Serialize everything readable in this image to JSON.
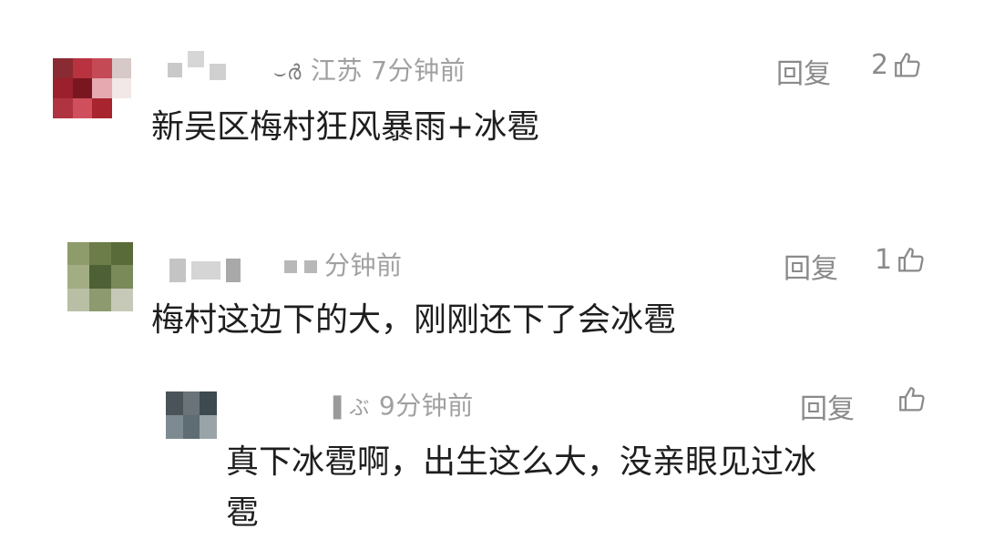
{
  "comments": [
    {
      "location_time": "江苏 7分钟前",
      "reply_label": "回复",
      "likes": "2",
      "text": "新吴区梅村狂风暴雨+冰雹"
    },
    {
      "location_time": "分钟前",
      "reply_label": "回复",
      "likes": "1",
      "text": "梅村这边下的大，刚刚还下了会冰雹"
    },
    {
      "location_time": "9分钟前",
      "reply_label": "回复",
      "likes": "",
      "text_line1": "真下冰雹啊，出生这么大，没亲眼见过冰",
      "text_line2": "雹"
    }
  ],
  "icons": {
    "like": "thumbs-up-icon"
  },
  "colors": {
    "meta": "#a0a0a0",
    "action": "#8a8a8a",
    "text": "#1e1e1e"
  }
}
